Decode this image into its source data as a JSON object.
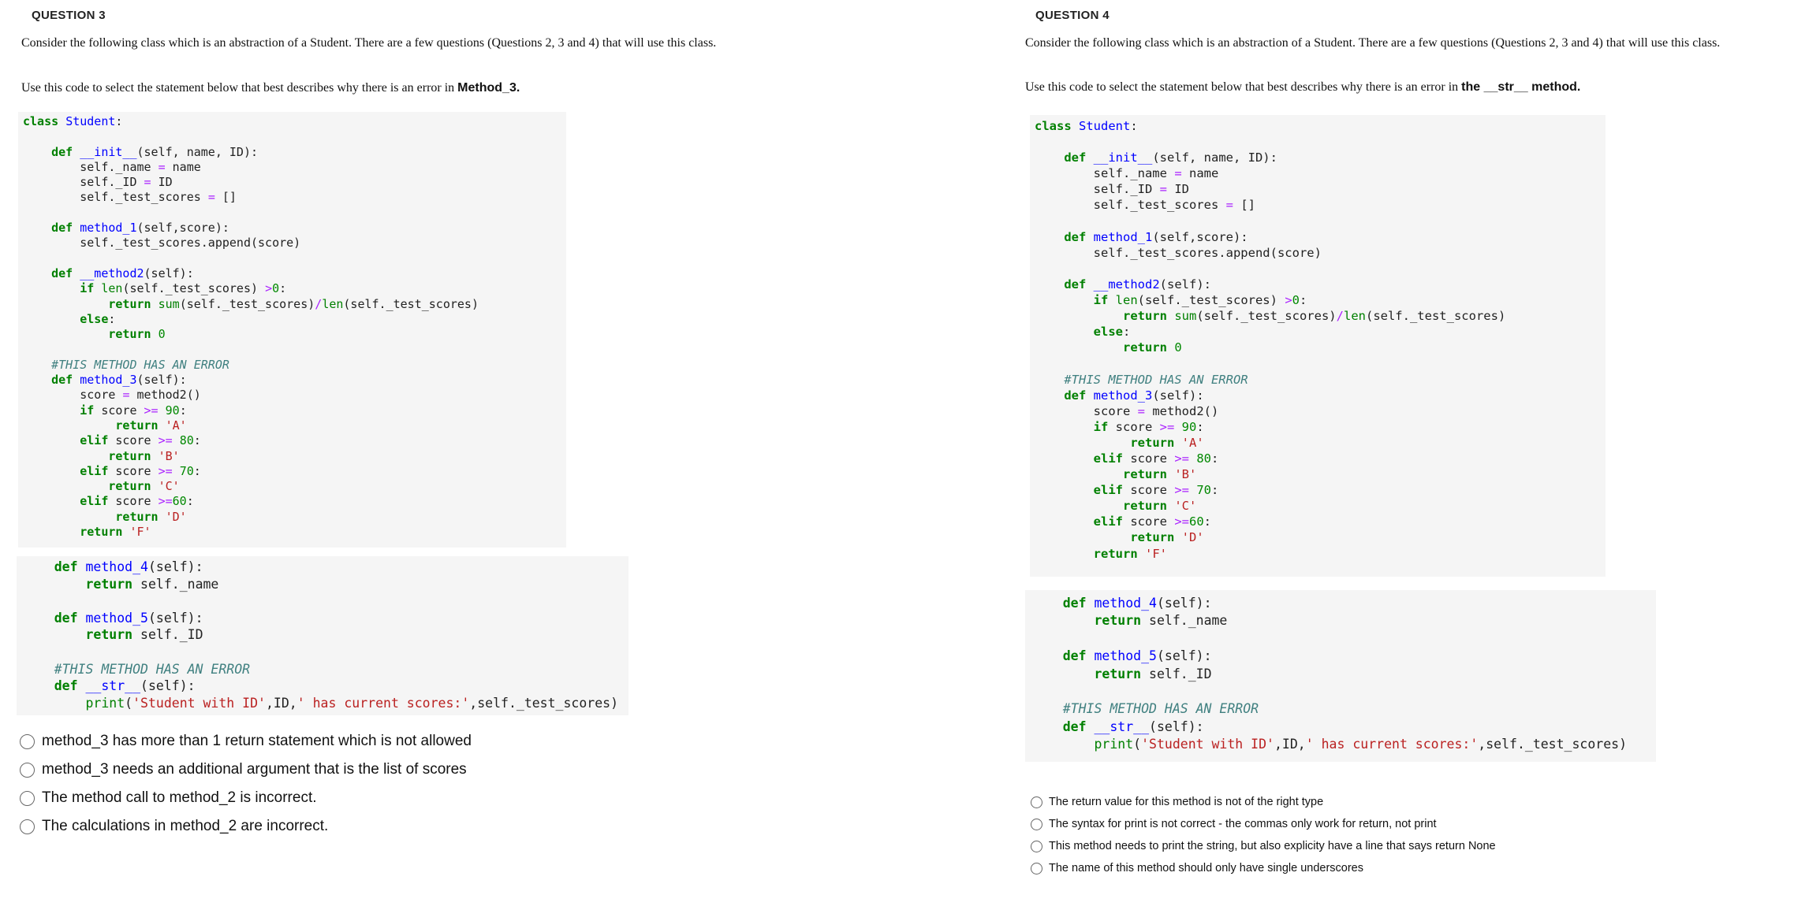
{
  "q3": {
    "title": "QUESTION 3",
    "intro": "Consider the following class which is an abstraction of a Student. There are a few questions (Questions 2, 3 and 4) that will use this class.",
    "prompt_prefix": "Use this code to select the statement below that best describes why there is an error in ",
    "prompt_emph": "Method_3.",
    "options": [
      "method_3 has more than 1 return statement which is not allowed",
      "method_3 needs an additional argument that is the list of scores",
      "The method call to method_2 is incorrect.",
      "The calculations in method_2 are incorrect."
    ]
  },
  "q4": {
    "title": "QUESTION 4",
    "intro": "Consider the following class which is an abstraction of a Student. There are a few questions (Questions 2, 3 and 4) that will use this class.",
    "prompt_prefix": "Use this code to select the statement below that best describes why there is an error in ",
    "prompt_emph": "the __str__ method.",
    "options": [
      "The return value for this method is not of the right type",
      "The syntax for print is not correct - the commas only work for return, not print",
      "This method needs to print the string, but also explicity have a line that says return None",
      "The name of this method should only have single underscores"
    ]
  },
  "code": {
    "part1": [
      "class Student:",
      "",
      "    def __init__(self, name, ID):",
      "        self._name = name",
      "        self._ID = ID",
      "        self._test_scores = []",
      "",
      "    def method_1(self,score):",
      "        self._test_scores.append(score)",
      "",
      "    def __method2(self):",
      "        if len(self._test_scores) >0:",
      "            return sum(self._test_scores)/len(self._test_scores)",
      "        else:",
      "            return 0",
      "",
      "    #THIS METHOD HAS AN ERROR",
      "    def method_3(self):",
      "        score = method2()",
      "        if score >= 90:",
      "             return 'A'",
      "        elif score >= 80:",
      "            return 'B'",
      "        elif score >= 70:",
      "            return 'C'",
      "        elif score >=60:",
      "             return 'D'",
      "        return 'F'"
    ],
    "part2": [
      "    def method_4(self):",
      "        return self._name",
      "",
      "    def method_5(self):",
      "        return self._ID",
      "",
      "    #THIS METHOD HAS AN ERROR",
      "    def __str__(self):",
      "        print('Student with ID',ID,' has current scores:',self._test_scores)"
    ]
  },
  "colors": {
    "keyword": "#008000",
    "function_name": "#0000ff",
    "operator": "#aa22ff",
    "number": "#008800",
    "string": "#ba2121",
    "comment": "#408080",
    "code_background": "#f5f5f5"
  },
  "icons": {
    "option": "radio-button-icon"
  }
}
